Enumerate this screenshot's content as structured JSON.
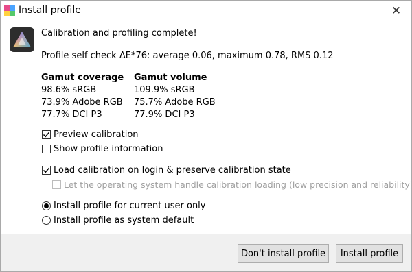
{
  "window": {
    "title": "Install profile"
  },
  "message": {
    "heading": "Calibration and profiling complete!",
    "self_check": "Profile self check ΔE*76: average 0.06, maximum 0.78, RMS 0.12"
  },
  "gamut": {
    "coverage": {
      "header": "Gamut coverage",
      "rows": [
        "98.6% sRGB",
        "73.9% Adobe RGB",
        "77.7% DCI P3"
      ]
    },
    "volume": {
      "header": "Gamut volume",
      "rows": [
        "109.9% sRGB",
        "75.7% Adobe RGB",
        "77.9% DCI P3"
      ]
    }
  },
  "options": {
    "preview_calibration": {
      "label": "Preview calibration",
      "checked": true
    },
    "show_profile_info": {
      "label": "Show profile information",
      "checked": false
    },
    "load_calibration": {
      "label": "Load calibration on login & preserve calibration state",
      "checked": true
    },
    "os_handle_loading": {
      "label": "Let the operating system handle calibration loading (low precision and reliability)",
      "checked": false,
      "enabled": false
    }
  },
  "install_scope": {
    "current_user": {
      "label": "Install profile for current user only",
      "selected": true
    },
    "system_default": {
      "label": "Install profile as system default",
      "selected": false
    }
  },
  "buttons": {
    "dont_install": "Don't install profile",
    "install": "Install profile"
  }
}
